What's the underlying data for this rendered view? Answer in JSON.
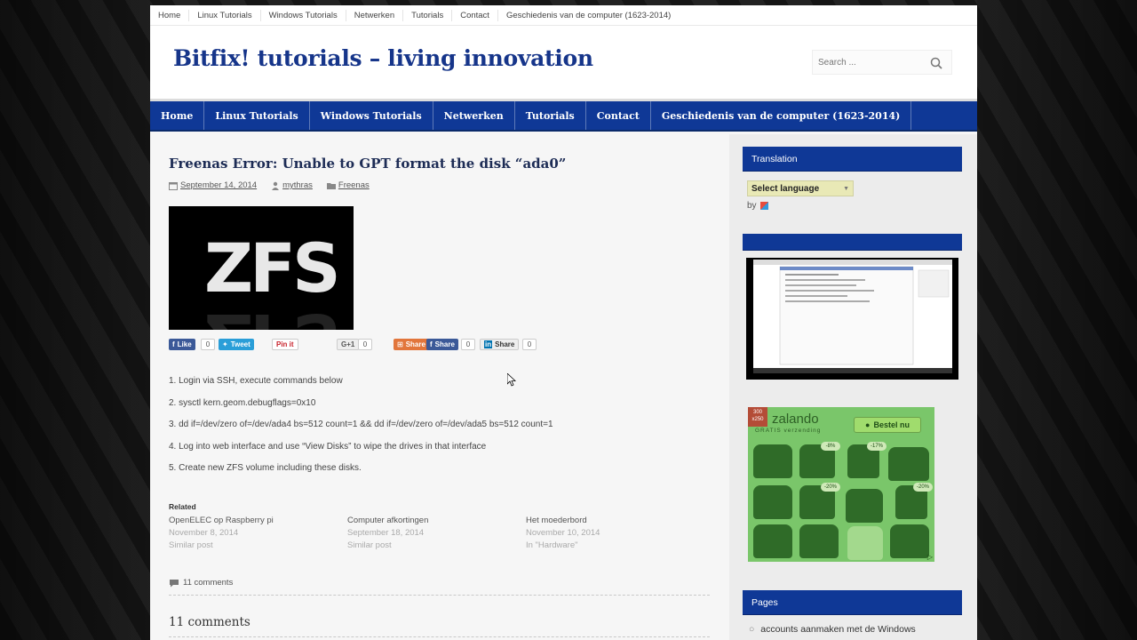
{
  "topnav": [
    "Home",
    "Linux Tutorials",
    "Windows Tutorials",
    "Netwerken",
    "Tutorials",
    "Contact",
    "Geschiedenis van de computer (1623-2014)"
  ],
  "site": {
    "title": "Bitfix! tutorials – living innovation"
  },
  "search": {
    "placeholder": "Search ..."
  },
  "mainnav": [
    "Home",
    "Linux Tutorials",
    "Windows Tutorials",
    "Netwerken",
    "Tutorials",
    "Contact",
    "Geschiedenis van de computer (1623-2014)"
  ],
  "post": {
    "title": "Freenas Error: Unable to GPT format the disk “ada0”",
    "date": "September 14, 2014",
    "author": "mythras",
    "category": "Freenas",
    "image_text": "ZFS",
    "share": {
      "like": "Like",
      "like_count": "0",
      "tweet": "Tweet",
      "pin": "Pin it",
      "gplus": "G+1",
      "gplus_count": "0",
      "share_orange": "Share",
      "share_fb": "Share",
      "share_fb_count": "0",
      "linkedin_share": "Share",
      "linkedin_count": "0"
    },
    "steps": [
      "1. Login via SSH, execute commands below",
      "2. sysctl kern.geom.debugflags=0x10",
      "3. dd if=/dev/zero of=/dev/ada4 bs=512 count=1 && dd if=/dev/zero of=/dev/ada5 bs=512 count=1",
      "4. Log into web interface and use “View Disks” to wipe the drives in that interface",
      "5. Create new ZFS volume including these disks."
    ],
    "related_heading": "Related",
    "related": [
      {
        "title": "OpenELEC op Raspberry pi",
        "date": "November 8, 2014",
        "note": "Similar post"
      },
      {
        "title": "Computer afkortingen",
        "date": "September 18, 2014",
        "note": "Similar post"
      },
      {
        "title": "Het moederbord",
        "date": "November 10, 2014",
        "note": "In \"Hardware\""
      }
    ],
    "comments_link": "11 comments",
    "comments_heading": "11 comments"
  },
  "sidebar": {
    "translation_title": "Translation",
    "language_select": "Select language",
    "by_label": "by",
    "video_title": "",
    "ad": {
      "brand": "zalando",
      "badge": "300 x250",
      "sub": "GRATIS verzending",
      "button": "Bestel nu",
      "discounts": [
        "-8%",
        "-17%",
        "-20%",
        "-20%"
      ]
    },
    "pages_title": "Pages",
    "pages": [
      "accounts aanmaken met de Windows"
    ]
  },
  "colors": {
    "brand_blue": "#0f3896",
    "title_blue": "#16358a",
    "ad_green": "#7ac66a"
  }
}
